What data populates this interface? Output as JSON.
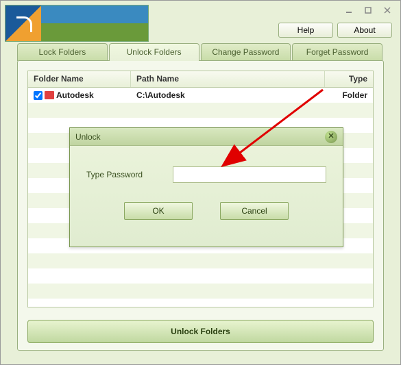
{
  "window": {
    "help_label": "Help",
    "about_label": "About"
  },
  "tabs": {
    "lock": "Lock Folders",
    "unlock": "Unlock Folders",
    "change": "Change Password",
    "forget": "Forget Password"
  },
  "table": {
    "headers": {
      "folder": "Folder Name",
      "path": "Path Name",
      "type": "Type"
    },
    "rows": [
      {
        "checked": true,
        "name": "Autodesk",
        "path": "C:\\Autodesk",
        "type": "Folder"
      }
    ]
  },
  "unlock_button": "Unlock Folders",
  "dialog": {
    "title": "Unlock",
    "label": "Type Password",
    "ok": "OK",
    "cancel": "Cancel",
    "value": ""
  }
}
